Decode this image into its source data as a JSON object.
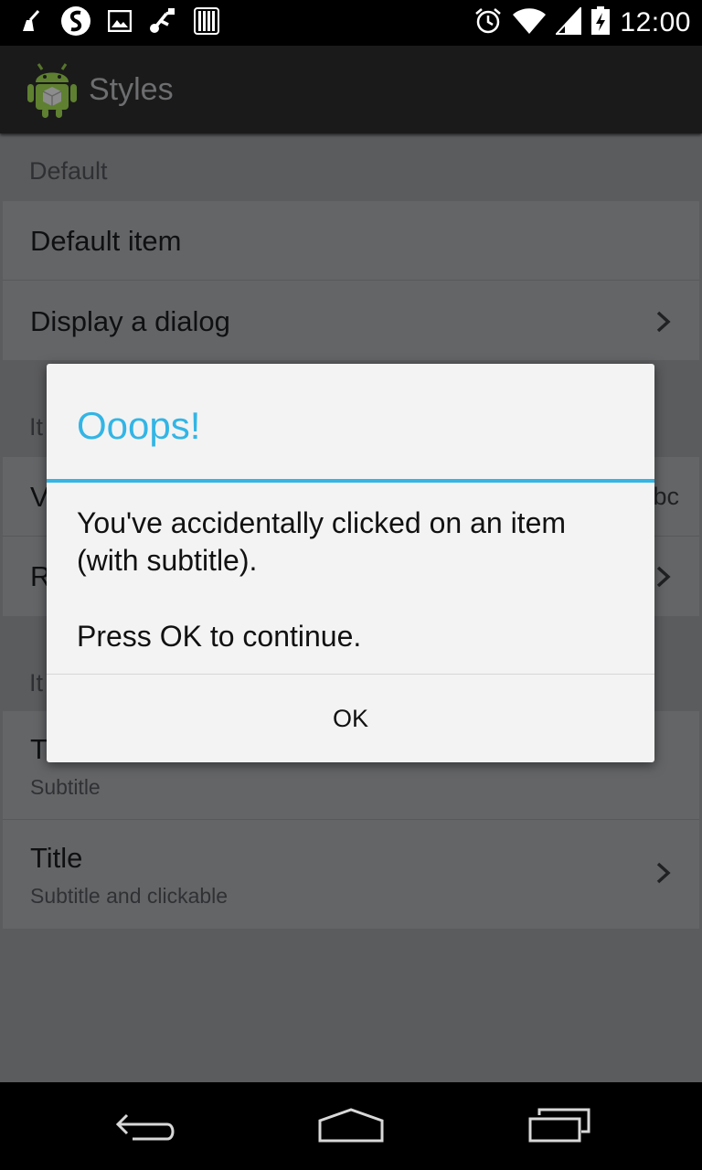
{
  "status_bar": {
    "time": "12:00",
    "left_icons": [
      "cleaner-icon",
      "swype-icon",
      "image-icon",
      "usb-icon",
      "barcode-icon"
    ],
    "right_icons": [
      "alarm-icon",
      "wifi-icon",
      "signal-icon",
      "battery-charging-icon"
    ]
  },
  "action_bar": {
    "title": "Styles",
    "icon": "android-app-icon"
  },
  "list": {
    "section_default": "Default",
    "items_default": [
      {
        "title": "Default item"
      },
      {
        "title": "Display a dialog"
      }
    ],
    "section_2_partial": "It",
    "row_v_partial": "V",
    "row_v_right_partial": "bc",
    "row_r_partial": "R",
    "section_3_partial": "It",
    "row_t_partial": "T",
    "row_t_subtitle": "Subtitle",
    "row_last_title": "Title",
    "row_last_subtitle": "Subtitle and clickable"
  },
  "dialog": {
    "title": "Ooops!",
    "message_line1": "You've accidentally clicked on an item (with subtitle).",
    "message_line2": "Press OK to continue.",
    "ok_label": "OK"
  },
  "nav_bar": {
    "buttons": [
      "back-icon",
      "home-icon",
      "recents-icon"
    ]
  },
  "colors": {
    "accent": "#33b5e5",
    "dim_background": "#5b5c5e",
    "dialog_background": "#f3f3f3"
  }
}
